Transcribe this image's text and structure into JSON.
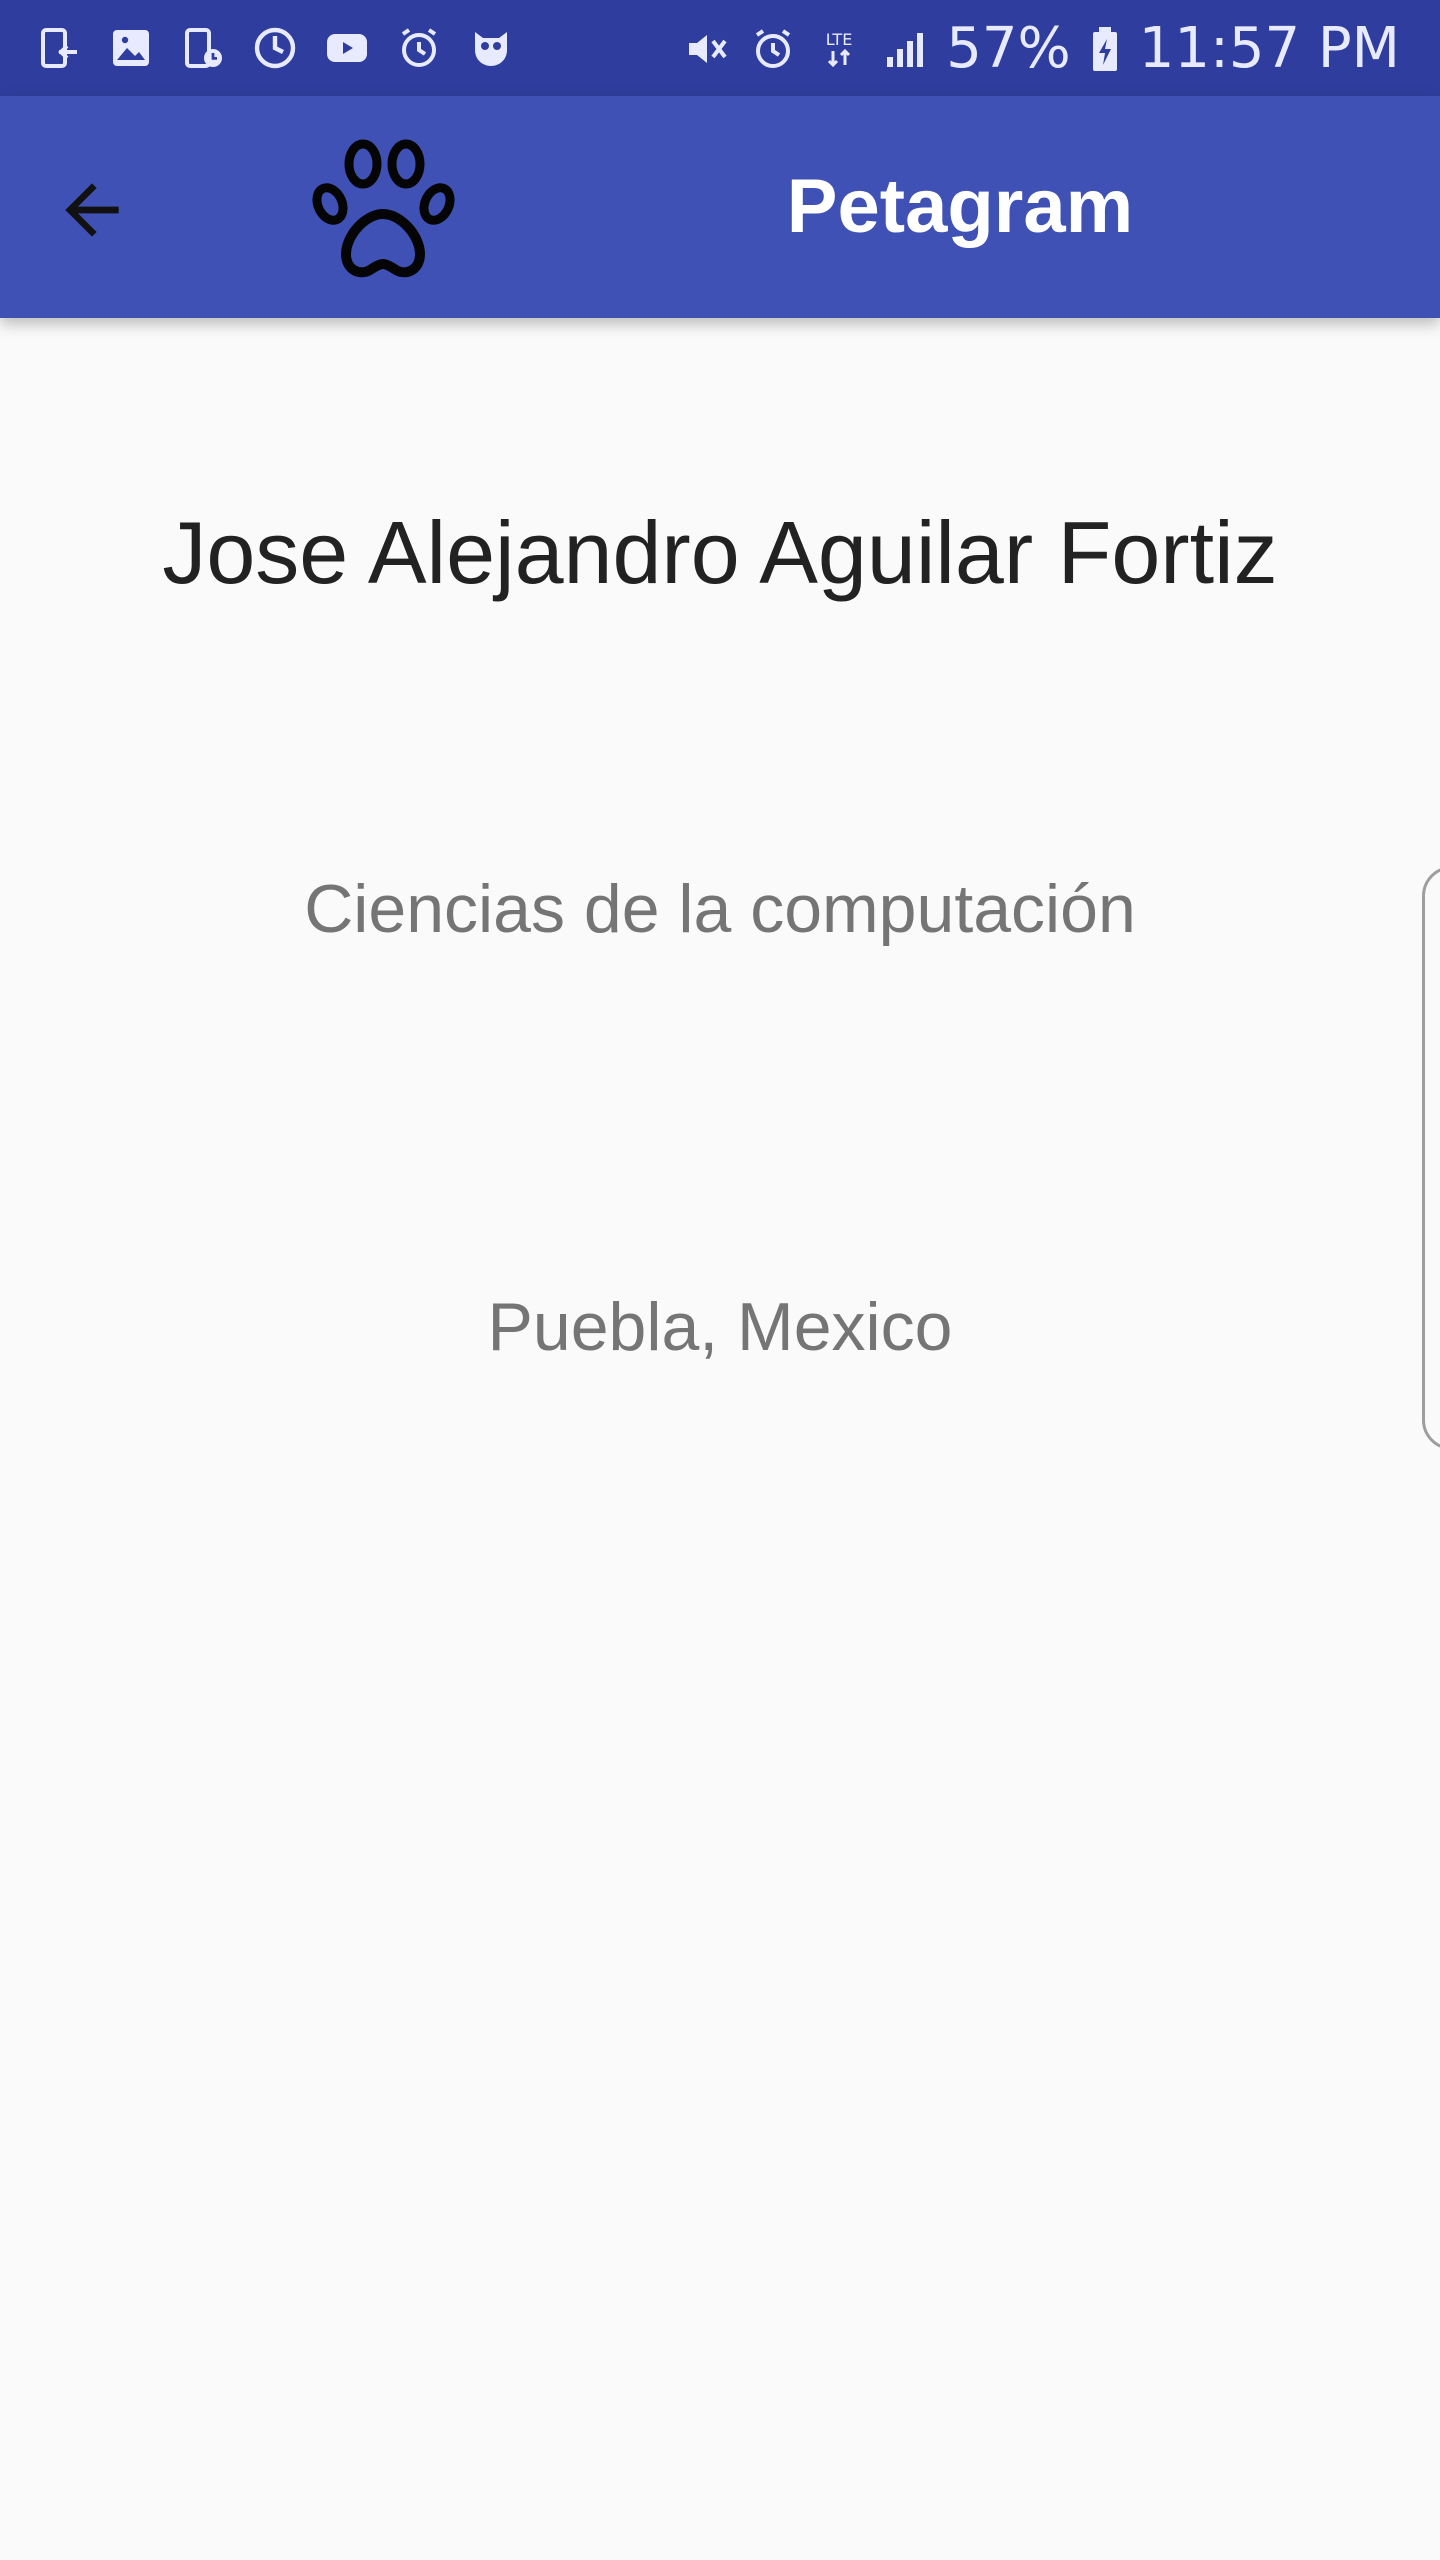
{
  "status_bar": {
    "left_icons": [
      "sim-notification-icon",
      "gallery-icon",
      "device-schedule-icon",
      "sync-icon",
      "youtube-icon",
      "alarm-icon",
      "owl-app-icon"
    ],
    "right_icons": [
      "vibrate-icon",
      "alarm-icon",
      "lte-data-icon",
      "signal-icon",
      "battery-charging-icon"
    ],
    "lte_label": "LTE",
    "battery_percent": "57%",
    "time": "11:57 PM"
  },
  "app_bar": {
    "title": "Petagram",
    "back_icon": "arrow-back-icon",
    "logo_icon": "paw-icon",
    "background_color": "#3f51b5"
  },
  "profile": {
    "name": "Jose Alejandro Aguilar Fortiz",
    "career": "Ciencias de la computación",
    "location": "Puebla, Mexico"
  },
  "colors": {
    "status_bar": "#2f3e9e",
    "primary": "#3f51b5",
    "background": "#fafafa",
    "primary_text": "#222222",
    "secondary_text": "#757575"
  }
}
